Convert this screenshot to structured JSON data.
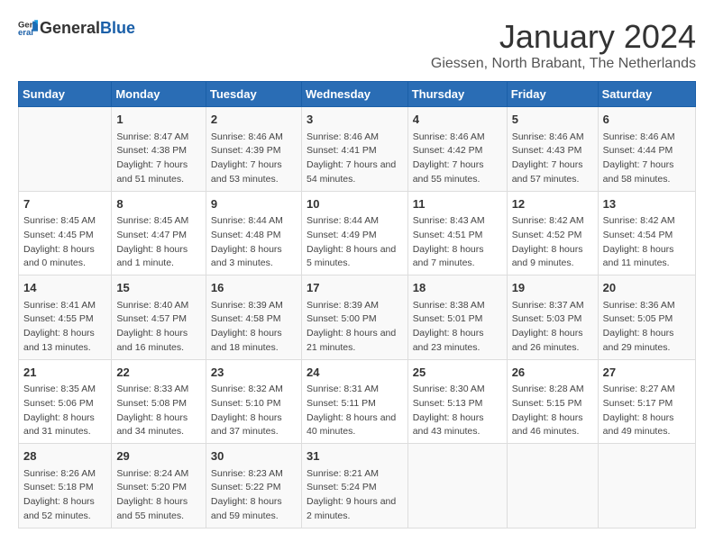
{
  "header": {
    "logo_general": "General",
    "logo_blue": "Blue",
    "title": "January 2024",
    "subtitle": "Giessen, North Brabant, The Netherlands"
  },
  "calendar": {
    "days_of_week": [
      "Sunday",
      "Monday",
      "Tuesday",
      "Wednesday",
      "Thursday",
      "Friday",
      "Saturday"
    ],
    "weeks": [
      [
        {
          "day": "",
          "sunrise": "",
          "sunset": "",
          "daylight": ""
        },
        {
          "day": "1",
          "sunrise": "Sunrise: 8:47 AM",
          "sunset": "Sunset: 4:38 PM",
          "daylight": "Daylight: 7 hours and 51 minutes."
        },
        {
          "day": "2",
          "sunrise": "Sunrise: 8:46 AM",
          "sunset": "Sunset: 4:39 PM",
          "daylight": "Daylight: 7 hours and 53 minutes."
        },
        {
          "day": "3",
          "sunrise": "Sunrise: 8:46 AM",
          "sunset": "Sunset: 4:41 PM",
          "daylight": "Daylight: 7 hours and 54 minutes."
        },
        {
          "day": "4",
          "sunrise": "Sunrise: 8:46 AM",
          "sunset": "Sunset: 4:42 PM",
          "daylight": "Daylight: 7 hours and 55 minutes."
        },
        {
          "day": "5",
          "sunrise": "Sunrise: 8:46 AM",
          "sunset": "Sunset: 4:43 PM",
          "daylight": "Daylight: 7 hours and 57 minutes."
        },
        {
          "day": "6",
          "sunrise": "Sunrise: 8:46 AM",
          "sunset": "Sunset: 4:44 PM",
          "daylight": "Daylight: 7 hours and 58 minutes."
        }
      ],
      [
        {
          "day": "7",
          "sunrise": "Sunrise: 8:45 AM",
          "sunset": "Sunset: 4:45 PM",
          "daylight": "Daylight: 8 hours and 0 minutes."
        },
        {
          "day": "8",
          "sunrise": "Sunrise: 8:45 AM",
          "sunset": "Sunset: 4:47 PM",
          "daylight": "Daylight: 8 hours and 1 minute."
        },
        {
          "day": "9",
          "sunrise": "Sunrise: 8:44 AM",
          "sunset": "Sunset: 4:48 PM",
          "daylight": "Daylight: 8 hours and 3 minutes."
        },
        {
          "day": "10",
          "sunrise": "Sunrise: 8:44 AM",
          "sunset": "Sunset: 4:49 PM",
          "daylight": "Daylight: 8 hours and 5 minutes."
        },
        {
          "day": "11",
          "sunrise": "Sunrise: 8:43 AM",
          "sunset": "Sunset: 4:51 PM",
          "daylight": "Daylight: 8 hours and 7 minutes."
        },
        {
          "day": "12",
          "sunrise": "Sunrise: 8:42 AM",
          "sunset": "Sunset: 4:52 PM",
          "daylight": "Daylight: 8 hours and 9 minutes."
        },
        {
          "day": "13",
          "sunrise": "Sunrise: 8:42 AM",
          "sunset": "Sunset: 4:54 PM",
          "daylight": "Daylight: 8 hours and 11 minutes."
        }
      ],
      [
        {
          "day": "14",
          "sunrise": "Sunrise: 8:41 AM",
          "sunset": "Sunset: 4:55 PM",
          "daylight": "Daylight: 8 hours and 13 minutes."
        },
        {
          "day": "15",
          "sunrise": "Sunrise: 8:40 AM",
          "sunset": "Sunset: 4:57 PM",
          "daylight": "Daylight: 8 hours and 16 minutes."
        },
        {
          "day": "16",
          "sunrise": "Sunrise: 8:39 AM",
          "sunset": "Sunset: 4:58 PM",
          "daylight": "Daylight: 8 hours and 18 minutes."
        },
        {
          "day": "17",
          "sunrise": "Sunrise: 8:39 AM",
          "sunset": "Sunset: 5:00 PM",
          "daylight": "Daylight: 8 hours and 21 minutes."
        },
        {
          "day": "18",
          "sunrise": "Sunrise: 8:38 AM",
          "sunset": "Sunset: 5:01 PM",
          "daylight": "Daylight: 8 hours and 23 minutes."
        },
        {
          "day": "19",
          "sunrise": "Sunrise: 8:37 AM",
          "sunset": "Sunset: 5:03 PM",
          "daylight": "Daylight: 8 hours and 26 minutes."
        },
        {
          "day": "20",
          "sunrise": "Sunrise: 8:36 AM",
          "sunset": "Sunset: 5:05 PM",
          "daylight": "Daylight: 8 hours and 29 minutes."
        }
      ],
      [
        {
          "day": "21",
          "sunrise": "Sunrise: 8:35 AM",
          "sunset": "Sunset: 5:06 PM",
          "daylight": "Daylight: 8 hours and 31 minutes."
        },
        {
          "day": "22",
          "sunrise": "Sunrise: 8:33 AM",
          "sunset": "Sunset: 5:08 PM",
          "daylight": "Daylight: 8 hours and 34 minutes."
        },
        {
          "day": "23",
          "sunrise": "Sunrise: 8:32 AM",
          "sunset": "Sunset: 5:10 PM",
          "daylight": "Daylight: 8 hours and 37 minutes."
        },
        {
          "day": "24",
          "sunrise": "Sunrise: 8:31 AM",
          "sunset": "Sunset: 5:11 PM",
          "daylight": "Daylight: 8 hours and 40 minutes."
        },
        {
          "day": "25",
          "sunrise": "Sunrise: 8:30 AM",
          "sunset": "Sunset: 5:13 PM",
          "daylight": "Daylight: 8 hours and 43 minutes."
        },
        {
          "day": "26",
          "sunrise": "Sunrise: 8:28 AM",
          "sunset": "Sunset: 5:15 PM",
          "daylight": "Daylight: 8 hours and 46 minutes."
        },
        {
          "day": "27",
          "sunrise": "Sunrise: 8:27 AM",
          "sunset": "Sunset: 5:17 PM",
          "daylight": "Daylight: 8 hours and 49 minutes."
        }
      ],
      [
        {
          "day": "28",
          "sunrise": "Sunrise: 8:26 AM",
          "sunset": "Sunset: 5:18 PM",
          "daylight": "Daylight: 8 hours and 52 minutes."
        },
        {
          "day": "29",
          "sunrise": "Sunrise: 8:24 AM",
          "sunset": "Sunset: 5:20 PM",
          "daylight": "Daylight: 8 hours and 55 minutes."
        },
        {
          "day": "30",
          "sunrise": "Sunrise: 8:23 AM",
          "sunset": "Sunset: 5:22 PM",
          "daylight": "Daylight: 8 hours and 59 minutes."
        },
        {
          "day": "31",
          "sunrise": "Sunrise: 8:21 AM",
          "sunset": "Sunset: 5:24 PM",
          "daylight": "Daylight: 9 hours and 2 minutes."
        },
        {
          "day": "",
          "sunrise": "",
          "sunset": "",
          "daylight": ""
        },
        {
          "day": "",
          "sunrise": "",
          "sunset": "",
          "daylight": ""
        },
        {
          "day": "",
          "sunrise": "",
          "sunset": "",
          "daylight": ""
        }
      ]
    ]
  }
}
